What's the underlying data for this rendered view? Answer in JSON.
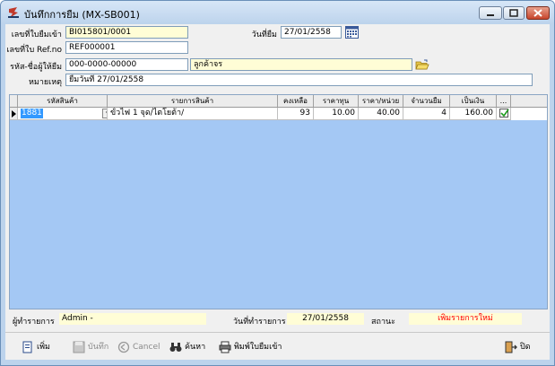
{
  "window": {
    "title": "บันทึกการยืม (MX-SB001)"
  },
  "header": {
    "doc_no_label": "เลขที่ใบยืมเข้า",
    "doc_no": "BI015801/0001",
    "date_label": "วันที่ยืม",
    "date": "27/01/2558",
    "ref_label": "เลขที่ใบ Ref.no",
    "ref_no": "REF000001",
    "borrower_label": "รหัส-ชื่อผู้ให้ยืม",
    "borrower_code": "000-0000-00000",
    "borrower_name": "ลูกค้าจร",
    "note_label": "หมายเหตุ",
    "note": "ยืมวันที่ 27/01/2558"
  },
  "grid": {
    "columns": [
      "รหัสสินค้า",
      "รายการสินค้า",
      "คงเหลือ",
      "ราคาทุน",
      "ราคา/หน่วย",
      "จำนวนยืม",
      "เป็นเงิน",
      "..."
    ],
    "rows": [
      {
        "code": "1881",
        "name": "ขั้วไฟ 1 จุด/ไตโยต้า/",
        "balance": "93",
        "cost": "10.00",
        "unit_price": "40.00",
        "qty": "4",
        "amount": "160.00",
        "checked": true
      }
    ]
  },
  "status": {
    "user_label": "ผู้ทำรายการ",
    "user": "Admin -",
    "trans_date_label": "วันที่ทำรายการ",
    "trans_date": "27/01/2558",
    "state_label": "สถานะ",
    "state": "เพิ่มรายการใหม่",
    "state_color": "#ff0000"
  },
  "toolbar": {
    "add": "เพิ่ม",
    "save": "บันทึก",
    "cancel": "Cancel",
    "search": "ค้นหา",
    "print": "พิมพ์ใบยืมเข้า",
    "close": "ปิด"
  }
}
